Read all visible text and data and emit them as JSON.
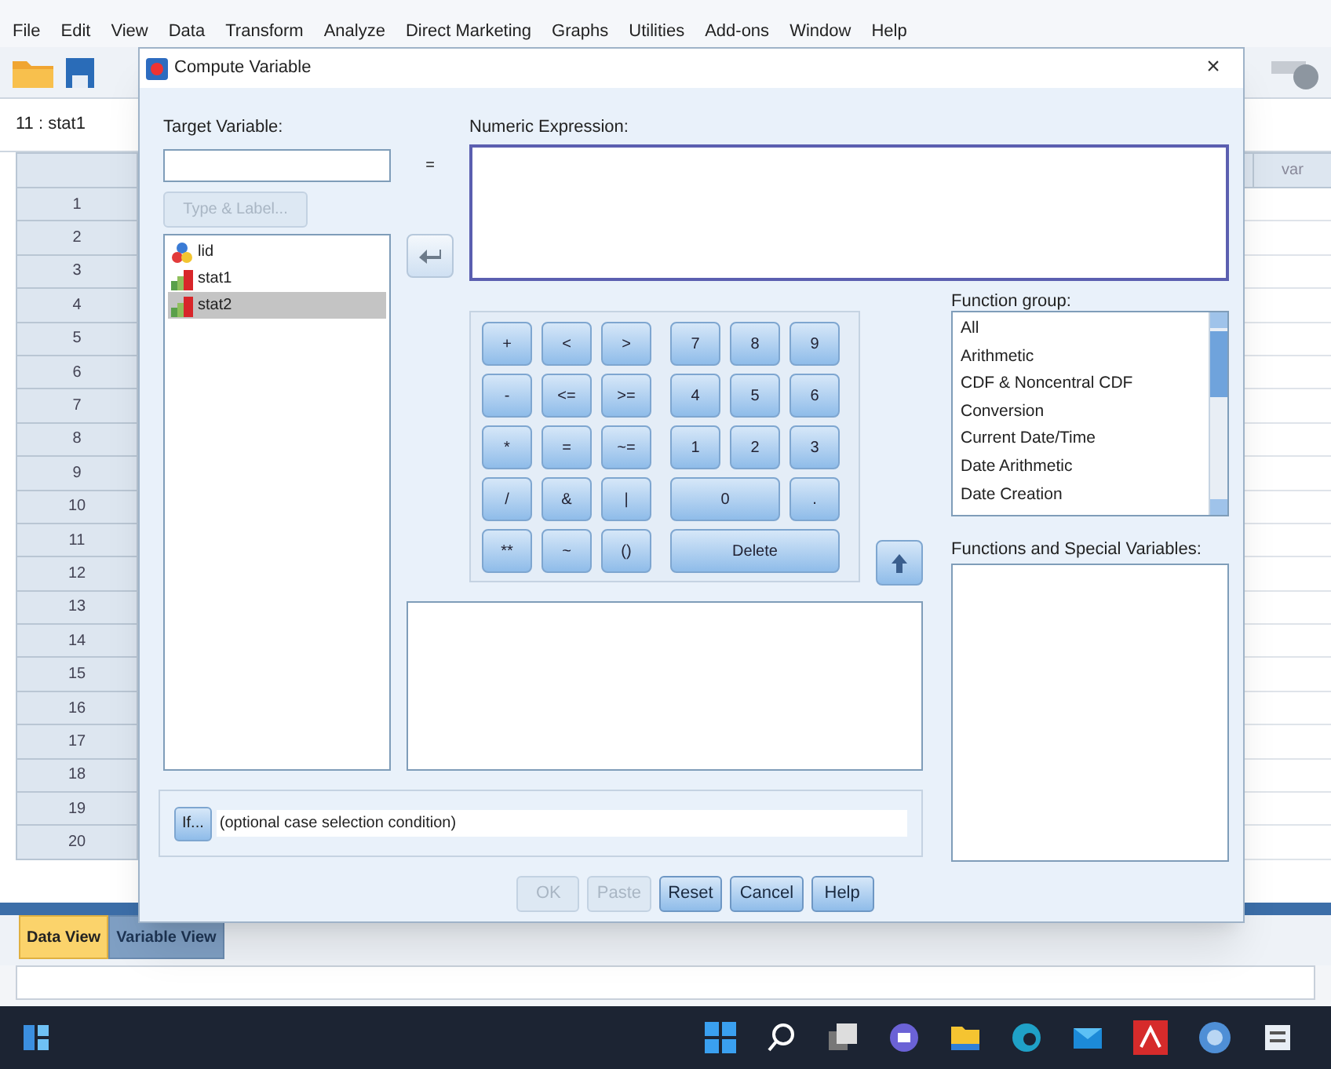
{
  "menu": [
    "File",
    "Edit",
    "View",
    "Data",
    "Transform",
    "Analyze",
    "Direct Marketing",
    "Graphs",
    "Utilities",
    "Add-ons",
    "Window",
    "Help"
  ],
  "cell_reference": "11 : stat1",
  "grid": {
    "column_header": "var",
    "row_numbers": [
      "1",
      "2",
      "3",
      "4",
      "5",
      "6",
      "7",
      "8",
      "9",
      "10",
      "11",
      "12",
      "13",
      "14",
      "15",
      "16",
      "17",
      "18",
      "19",
      "20"
    ]
  },
  "dialog": {
    "title": "Compute Variable",
    "close": "×",
    "target_variable": {
      "label": "Target Variable:"
    },
    "equals": "=",
    "type_label_button": {
      "label": "Type & Label...",
      "disabled": true
    },
    "variables": [
      {
        "name": "lid",
        "kind": "nominal",
        "selected": false
      },
      {
        "name": "stat1",
        "kind": "scale",
        "selected": false
      },
      {
        "name": "stat2",
        "kind": "scale",
        "selected": true
      }
    ],
    "numeric_expression": {
      "label": "Numeric Expression:"
    },
    "operator_keys": [
      "+",
      "<",
      ">",
      "-",
      "<=",
      ">=",
      "*",
      "=",
      "~=",
      "/",
      "&",
      "|",
      "**",
      "~",
      "()"
    ],
    "number_keys": [
      {
        "label": "7",
        "kind": "single"
      },
      {
        "label": "8",
        "kind": "single"
      },
      {
        "label": "9",
        "kind": "single"
      },
      {
        "label": "4",
        "kind": "single"
      },
      {
        "label": "5",
        "kind": "single"
      },
      {
        "label": "6",
        "kind": "single"
      },
      {
        "label": "1",
        "kind": "single"
      },
      {
        "label": "2",
        "kind": "single"
      },
      {
        "label": "3",
        "kind": "single"
      },
      {
        "label": "0",
        "kind": "double"
      },
      {
        "label": ".",
        "kind": "single"
      },
      {
        "label": "Delete",
        "kind": "triple"
      }
    ],
    "function_group": {
      "label": "Function group:",
      "items": [
        "All",
        "Arithmetic",
        "CDF & Noncentral CDF",
        "Conversion",
        "Current Date/Time",
        "Date Arithmetic",
        "Date Creation"
      ]
    },
    "functions": {
      "label": "Functions and Special Variables:"
    },
    "if_button": "If...",
    "if_condition": "(optional case selection condition)",
    "buttons": [
      {
        "label": "OK",
        "disabled": true
      },
      {
        "label": "Paste",
        "disabled": true
      },
      {
        "label": "Reset",
        "disabled": false
      },
      {
        "label": "Cancel",
        "disabled": false
      },
      {
        "label": "Help",
        "disabled": false
      }
    ]
  },
  "tabs": [
    {
      "label": "Data View",
      "selected": true
    },
    {
      "label": "Variable View",
      "selected": false
    }
  ]
}
